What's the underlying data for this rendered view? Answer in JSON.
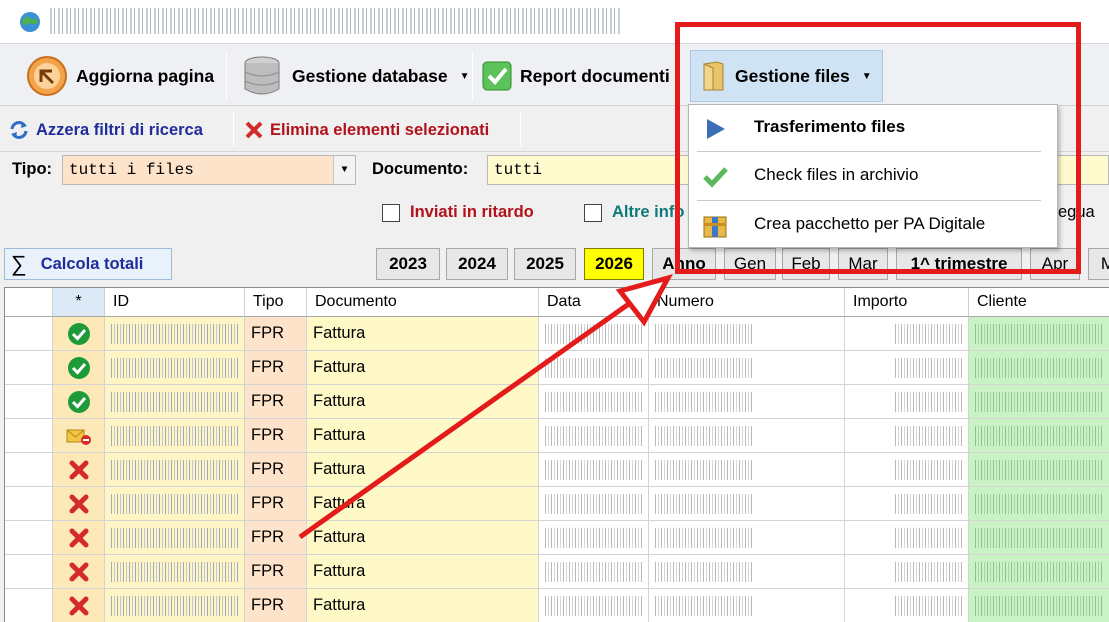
{
  "toolbar": {
    "refresh_label": "Aggiorna pagina",
    "database_label": "Gestione database",
    "report_label": "Report documenti",
    "files_label": "Gestione files"
  },
  "filterbar": {
    "reset_label": "Azzera filtri di ricerca",
    "delete_label": "Elimina elementi selezionati"
  },
  "filters": {
    "tipo_label": "Tipo:",
    "tipo_value": "tutti i files",
    "documento_label": "Documento:",
    "documento_value": "tutti",
    "late_label": "Inviati in ritardo",
    "other_label": "Altre info",
    "right_label": "egua"
  },
  "years": {
    "calc_label": "Calcola totali",
    "items": [
      "2023",
      "2024",
      "2025",
      "2026"
    ],
    "selected": "2026",
    "anno_label": "Anno",
    "months": [
      "Gen",
      "Feb",
      "Mar"
    ],
    "quarter_label": "1^ trimestre",
    "month_apr": "Apr",
    "month_cut": "M"
  },
  "grid": {
    "headers": [
      "*",
      "ID",
      "Tipo",
      "Documento",
      "Data",
      "Numero",
      "Importo",
      "Cliente"
    ],
    "rows": [
      {
        "status": "ok",
        "tipo": "FPR",
        "documento": "Fattura"
      },
      {
        "status": "ok",
        "tipo": "FPR",
        "documento": "Fattura"
      },
      {
        "status": "ok",
        "tipo": "FPR",
        "documento": "Fattura"
      },
      {
        "status": "pending",
        "tipo": "FPR",
        "documento": "Fattura"
      },
      {
        "status": "error",
        "tipo": "FPR",
        "documento": "Fattura"
      },
      {
        "status": "error",
        "tipo": "FPR",
        "documento": "Fattura"
      },
      {
        "status": "error",
        "tipo": "FPR",
        "documento": "Fattura"
      },
      {
        "status": "error",
        "tipo": "FPR",
        "documento": "Fattura"
      },
      {
        "status": "error",
        "tipo": "FPR",
        "documento": "Fattura"
      }
    ]
  },
  "menu": {
    "items": [
      {
        "label": "Trasferimento files",
        "icon": "play-icon",
        "bold": true
      },
      {
        "label": "Check files in archivio",
        "icon": "checkmark-icon",
        "bold": false
      },
      {
        "label": "Crea pacchetto per PA Digitale",
        "icon": "package-icon",
        "bold": false
      }
    ]
  },
  "colors": {
    "annotation": "#e31b1b",
    "menu_highlight": "#cfe3f5",
    "year_selected": "#ffff00",
    "status_ok": "#1d9a3a",
    "status_error": "#d42a2a"
  }
}
